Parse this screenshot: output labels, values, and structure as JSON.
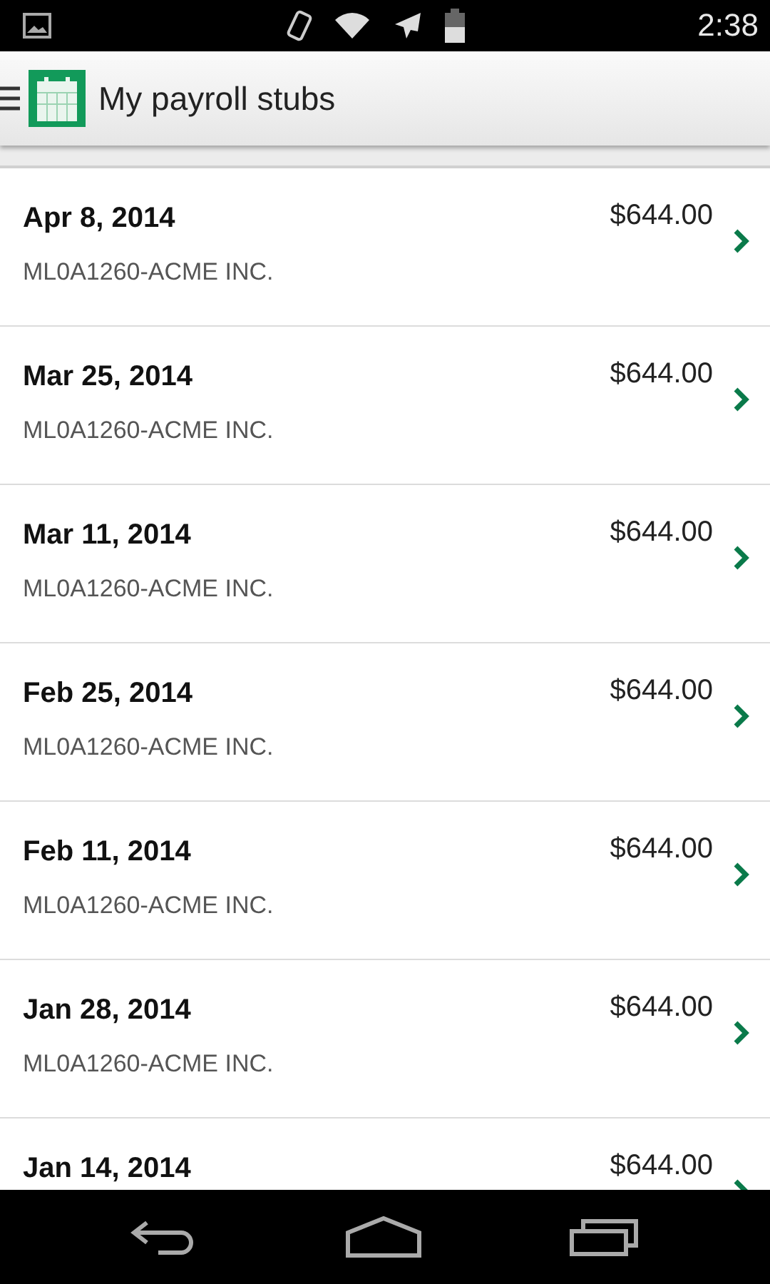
{
  "status_bar": {
    "time": "2:38"
  },
  "app_bar": {
    "title": "My payroll stubs"
  },
  "stubs": [
    {
      "date": "Apr 8, 2014",
      "amount": "$644.00",
      "company": "ML0A1260-ACME INC."
    },
    {
      "date": "Mar 25, 2014",
      "amount": "$644.00",
      "company": "ML0A1260-ACME INC."
    },
    {
      "date": "Mar 11, 2014",
      "amount": "$644.00",
      "company": "ML0A1260-ACME INC."
    },
    {
      "date": "Feb 25, 2014",
      "amount": "$644.00",
      "company": "ML0A1260-ACME INC."
    },
    {
      "date": "Feb 11, 2014",
      "amount": "$644.00",
      "company": "ML0A1260-ACME INC."
    },
    {
      "date": "Jan 28, 2014",
      "amount": "$644.00",
      "company": "ML0A1260-ACME INC."
    },
    {
      "date": "Jan 14, 2014",
      "amount": "$644.00"
    }
  ]
}
